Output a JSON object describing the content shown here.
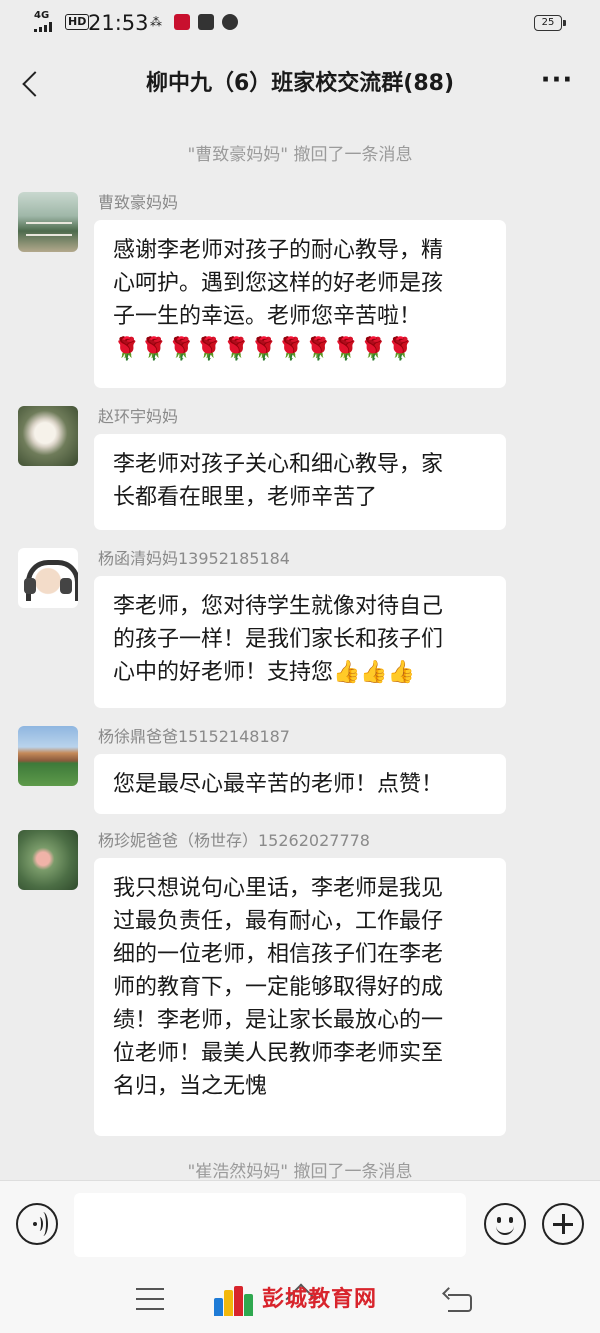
{
  "status_bar": {
    "network": "4G",
    "hd": "HD",
    "time": "21:53",
    "battery": "25"
  },
  "header": {
    "title": "柳中九（6）班家校交流群(88)",
    "more_label": "···"
  },
  "system_messages": {
    "top": "\"曹致豪妈妈\" 撤回了一条消息",
    "bottom": "\"崔浩然妈妈\" 撤回了一条消息"
  },
  "messages": [
    {
      "sender": "曹致豪妈妈",
      "lines": [
        "感谢李老师对孩子的耐心教导，精",
        "心呵护。遇到您这样的好老师是孩",
        "子一生的幸运。老师您辛苦啦！",
        "🌹🌹🌹🌹🌹🌹🌹🌹🌹🌹🌹"
      ]
    },
    {
      "sender": "赵环宇妈妈",
      "lines": [
        "李老师对孩子关心和细心教导，家",
        "长都看在眼里，老师辛苦了"
      ]
    },
    {
      "sender": "杨函清妈妈13952185184",
      "lines": [
        "李老师，您对待学生就像对待自己",
        "的孩子一样！是我们家长和孩子们",
        "心中的好老师！支持您👍👍👍"
      ]
    },
    {
      "sender": "杨徐鼎爸爸15152148187",
      "lines": [
        "您是最尽心最辛苦的老师！点赞！"
      ]
    },
    {
      "sender": "杨珍妮爸爸（杨世存）15262027778",
      "lines": [
        "我只想说句心里话，李老师是我见",
        "过最负责任，最有耐心，工作最仔",
        "细的一位老师，相信孩子们在李老",
        "师的教育下，一定能够取得好的成",
        "绩！李老师，是让家长最放心的一",
        "位老师！最美人民教师李老师实至",
        "名归，当之无愧"
      ]
    }
  ],
  "input_bar": {
    "placeholder": ""
  },
  "watermark": {
    "text": "彭城教育网"
  },
  "colors": {
    "background": "#ededed",
    "bubble": "#ffffff",
    "watermark_red": "#d8242c",
    "system_text": "#9b9b9b"
  }
}
